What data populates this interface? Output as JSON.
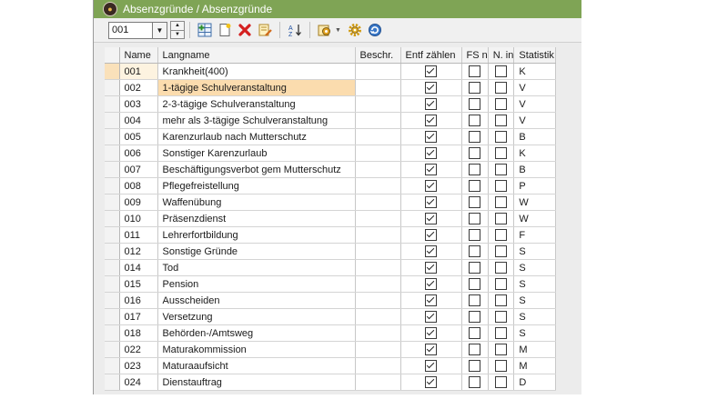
{
  "window": {
    "title": "Absenzgründe / Absenzgründe"
  },
  "toolbar": {
    "code_value": "001",
    "icons": [
      "list-add-icon",
      "new-document-icon",
      "delete-icon",
      "edit-report-icon",
      "sort-icon",
      "options-icon",
      "settings-gear-icon",
      "refresh-icon"
    ]
  },
  "grid": {
    "columns": [
      "Name",
      "Langname",
      "Beschr.",
      "Entf zählen",
      "FS n",
      "N. in",
      "Statistik"
    ],
    "selected_row": 1,
    "rows": [
      {
        "name": "001",
        "langname": "Krankheit(400)",
        "beschr": "",
        "entf": true,
        "fs": false,
        "nin": false,
        "stat": "K"
      },
      {
        "name": "002",
        "langname": "1-tägige Schulveranstaltung",
        "beschr": "",
        "entf": true,
        "fs": false,
        "nin": false,
        "stat": "V"
      },
      {
        "name": "003",
        "langname": "2-3-tägige Schulveranstaltung",
        "beschr": "",
        "entf": true,
        "fs": false,
        "nin": false,
        "stat": "V"
      },
      {
        "name": "004",
        "langname": "mehr als 3-tägige Schulveranstaltung",
        "beschr": "",
        "entf": true,
        "fs": false,
        "nin": false,
        "stat": "V"
      },
      {
        "name": "005",
        "langname": "Karenzurlaub nach Mutterschutz",
        "beschr": "",
        "entf": true,
        "fs": false,
        "nin": false,
        "stat": "B"
      },
      {
        "name": "006",
        "langname": "Sonstiger Karenzurlaub",
        "beschr": "",
        "entf": true,
        "fs": false,
        "nin": false,
        "stat": "K"
      },
      {
        "name": "007",
        "langname": "Beschäftigungsverbot gem Mutterschutz",
        "beschr": "",
        "entf": true,
        "fs": false,
        "nin": false,
        "stat": "B"
      },
      {
        "name": "008",
        "langname": "Pflegefreistellung",
        "beschr": "",
        "entf": true,
        "fs": false,
        "nin": false,
        "stat": "P"
      },
      {
        "name": "009",
        "langname": "Waffenübung",
        "beschr": "",
        "entf": true,
        "fs": false,
        "nin": false,
        "stat": "W"
      },
      {
        "name": "010",
        "langname": "Präsenzdienst",
        "beschr": "",
        "entf": true,
        "fs": false,
        "nin": false,
        "stat": "W"
      },
      {
        "name": "011",
        "langname": "Lehrerfortbildung",
        "beschr": "",
        "entf": true,
        "fs": false,
        "nin": false,
        "stat": "F"
      },
      {
        "name": "012",
        "langname": "Sonstige Gründe",
        "beschr": "",
        "entf": true,
        "fs": false,
        "nin": false,
        "stat": "S"
      },
      {
        "name": "014",
        "langname": "Tod",
        "beschr": "",
        "entf": true,
        "fs": false,
        "nin": false,
        "stat": "S"
      },
      {
        "name": "015",
        "langname": "Pension",
        "beschr": "",
        "entf": true,
        "fs": false,
        "nin": false,
        "stat": "S"
      },
      {
        "name": "016",
        "langname": "Ausscheiden",
        "beschr": "",
        "entf": true,
        "fs": false,
        "nin": false,
        "stat": "S"
      },
      {
        "name": "017",
        "langname": "Versetzung",
        "beschr": "",
        "entf": true,
        "fs": false,
        "nin": false,
        "stat": "S"
      },
      {
        "name": "018",
        "langname": "Behörden-/Amtsweg",
        "beschr": "",
        "entf": true,
        "fs": false,
        "nin": false,
        "stat": "S"
      },
      {
        "name": "022",
        "langname": "Maturakommission",
        "beschr": "",
        "entf": true,
        "fs": false,
        "nin": false,
        "stat": "M"
      },
      {
        "name": "023",
        "langname": "Maturaaufsicht",
        "beschr": "",
        "entf": true,
        "fs": false,
        "nin": false,
        "stat": "M"
      },
      {
        "name": "024",
        "langname": "Dienstauftrag",
        "beschr": "",
        "entf": true,
        "fs": false,
        "nin": false,
        "stat": "D"
      }
    ]
  }
}
